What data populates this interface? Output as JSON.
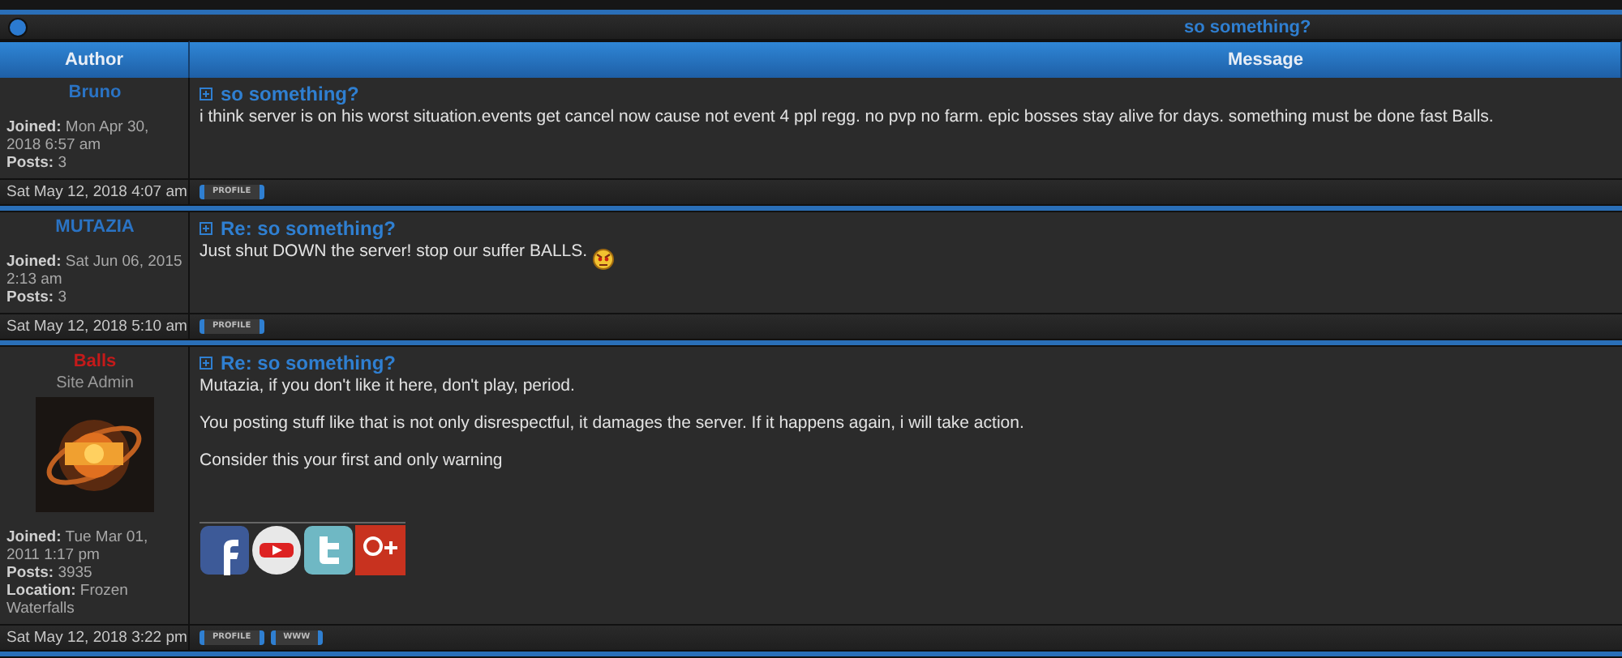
{
  "topic_title": "so something?",
  "columns": [
    "Author",
    "Message"
  ],
  "posts": [
    {
      "author": "Bruno",
      "color": "#2a73c4",
      "details": [
        {
          "label": "Joined:",
          "value": "Mon Apr 30, 2018 6:57 am"
        },
        {
          "label": "Posts:",
          "value": "3"
        }
      ],
      "subject": "so something?",
      "body": [
        "i think server is on his worst situation.events get cancel now cause not event 4 ppl regg. no pvp no farm. epic bosses stay alive for days. something must be done fast Balls."
      ],
      "date": "Sat May 12, 2018 4:07 am",
      "buttons": [
        "PROFILE"
      ]
    },
    {
      "author": "MUTAZIA",
      "color": "#2a73c4",
      "details": [
        {
          "label": "Joined:",
          "value": "Sat Jun 06, 2015 2:13 am"
        },
        {
          "label": "Posts:",
          "value": "3"
        }
      ],
      "subject": "Re: so something?",
      "body": [
        "Just shut DOWN the server! stop our suffer BALLS."
      ],
      "smiley": {
        "kind": "angry"
      },
      "date": "Sat May 12, 2018 5:10 am",
      "buttons": [
        "PROFILE"
      ]
    },
    {
      "author": "Balls",
      "color": "#c41a1a",
      "rank": "Site Admin",
      "avatar": {
        "kind": "picture"
      },
      "details": [
        {
          "label": "Joined:",
          "value": "Tue Mar 01, 2011 1:17 pm"
        },
        {
          "label": "Posts:",
          "value": "3935"
        },
        {
          "label": "Location:",
          "value": "Frozen Waterfalls"
        }
      ],
      "subject": "Re: so something?",
      "body": [
        "Mutazia, if you don't like it here, don't play, period.",
        "You posting stuff like that is not only disrespectful, it damages the server. If it happens again, i will take action.",
        "Consider this your first and only warning"
      ],
      "social_icons": [
        {
          "kind": "facebook"
        },
        {
          "kind": "video"
        },
        {
          "kind": "bird"
        },
        {
          "kind": "plus"
        }
      ],
      "date": "Sat May 12, 2018 3:22 pm",
      "buttons": [
        "PROFILE",
        "WWW"
      ]
    }
  ]
}
